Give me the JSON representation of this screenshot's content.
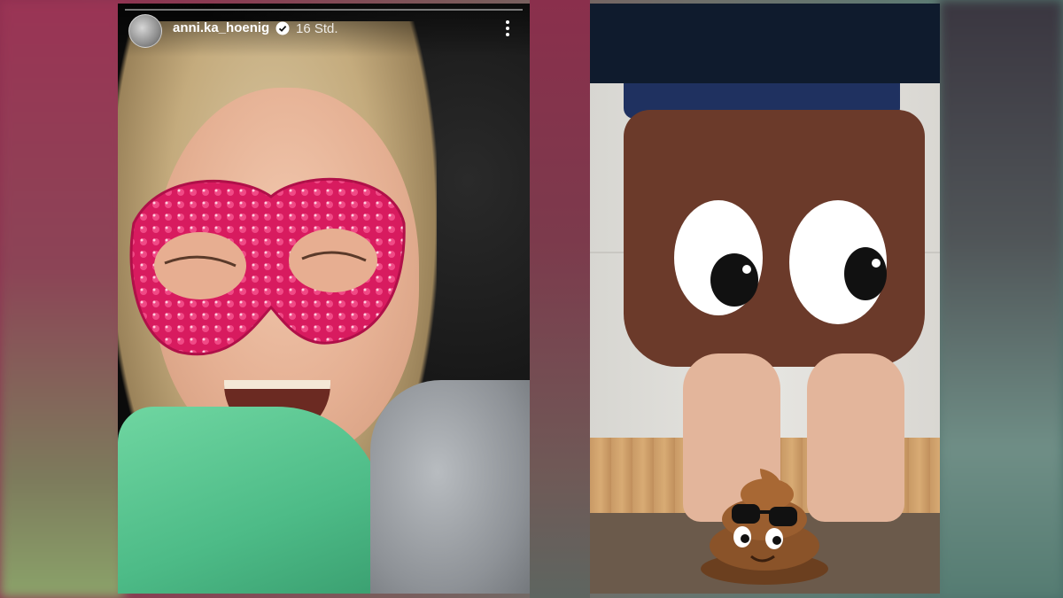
{
  "story": {
    "username": "anni.ka_hoenig",
    "timestamp": "16 Std.",
    "icons": {
      "avatar": "avatar",
      "verified": "verified-badge-icon",
      "more": "more-options-icon"
    }
  },
  "colors": {
    "accent_left": "#8e2e4f",
    "accent_right": "#4a6f6a",
    "verified": "#ffffff"
  }
}
